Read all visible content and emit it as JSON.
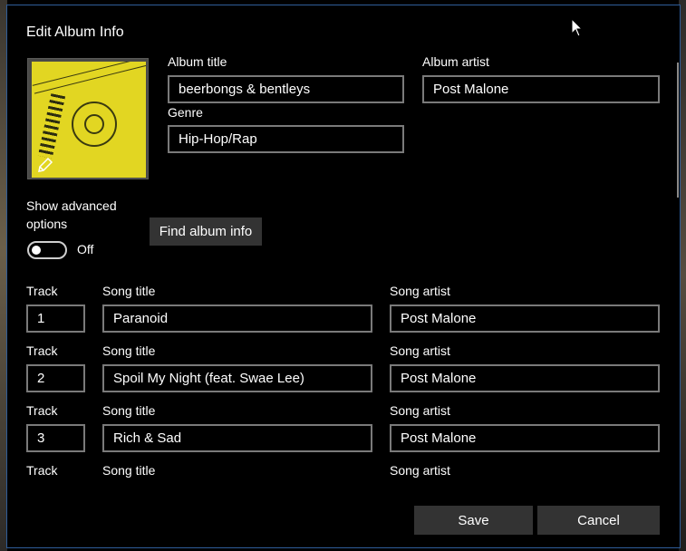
{
  "dialog": {
    "title": "Edit Album Info",
    "album_art": {
      "icon": "pencil-edit-icon",
      "color": "#e2d622"
    },
    "album_title_label": "Album title",
    "album_title_value": "beerbongs & bentleys",
    "album_artist_label": "Album artist",
    "album_artist_value": "Post Malone",
    "genre_label": "Genre",
    "genre_value": "Hip-Hop/Rap",
    "advanced_label": "Show advanced options",
    "advanced_toggle_state": "Off",
    "find_button": "Find album info",
    "tracks": [
      {
        "track_label": "Track",
        "song_label": "Song title",
        "artist_label": "Song artist",
        "track": "1",
        "title": "Paranoid",
        "artist": "Post Malone"
      },
      {
        "track_label": "Track",
        "song_label": "Song title",
        "artist_label": "Song artist",
        "track": "2",
        "title": "Spoil My Night (feat. Swae Lee)",
        "artist": "Post Malone"
      },
      {
        "track_label": "Track",
        "song_label": "Song title",
        "artist_label": "Song artist",
        "track": "3",
        "title": "Rich & Sad",
        "artist": "Post Malone"
      },
      {
        "track_label": "Track",
        "song_label": "Song title",
        "artist_label": "Song artist"
      }
    ],
    "save_button": "Save",
    "cancel_button": "Cancel"
  },
  "colors": {
    "accent_border": "#2f5d9a",
    "button_bg": "#333333",
    "field_border": "#7a7a7a"
  }
}
